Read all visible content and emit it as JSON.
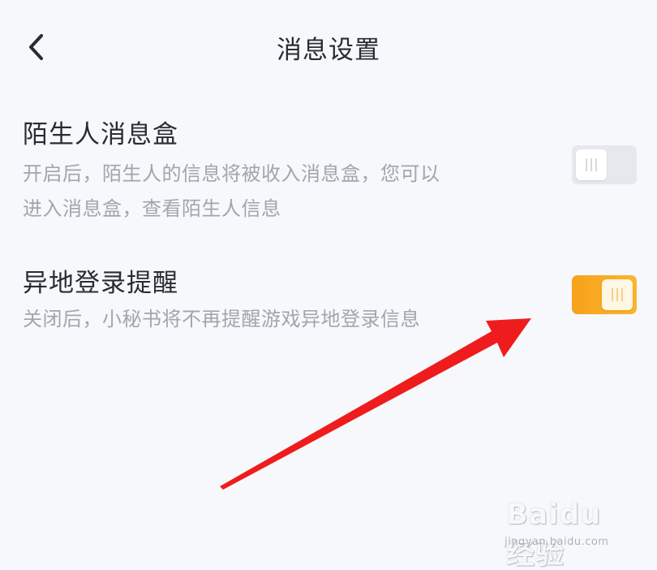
{
  "header": {
    "title": "消息设置",
    "back_icon": "chevron-left-icon"
  },
  "settings": [
    {
      "title": "陌生人消息盒",
      "description_lines": [
        "开启后，陌生人的信息将被收入消息盒，您可以",
        "进入消息盒，查看陌生人信息"
      ],
      "enabled": false
    },
    {
      "title": "异地登录提醒",
      "description_lines": [
        "关闭后，小秘书将不再提醒游戏异地登录信息"
      ],
      "enabled": true
    }
  ],
  "colors": {
    "background": "#f7f8fb",
    "toggle_on": "#f7a21b",
    "toggle_off": "#e6e8ed",
    "annotation_arrow": "#ee1c1c"
  },
  "watermark": {
    "logo": "Baidu经验",
    "url": "jingyan.baidu.com"
  }
}
